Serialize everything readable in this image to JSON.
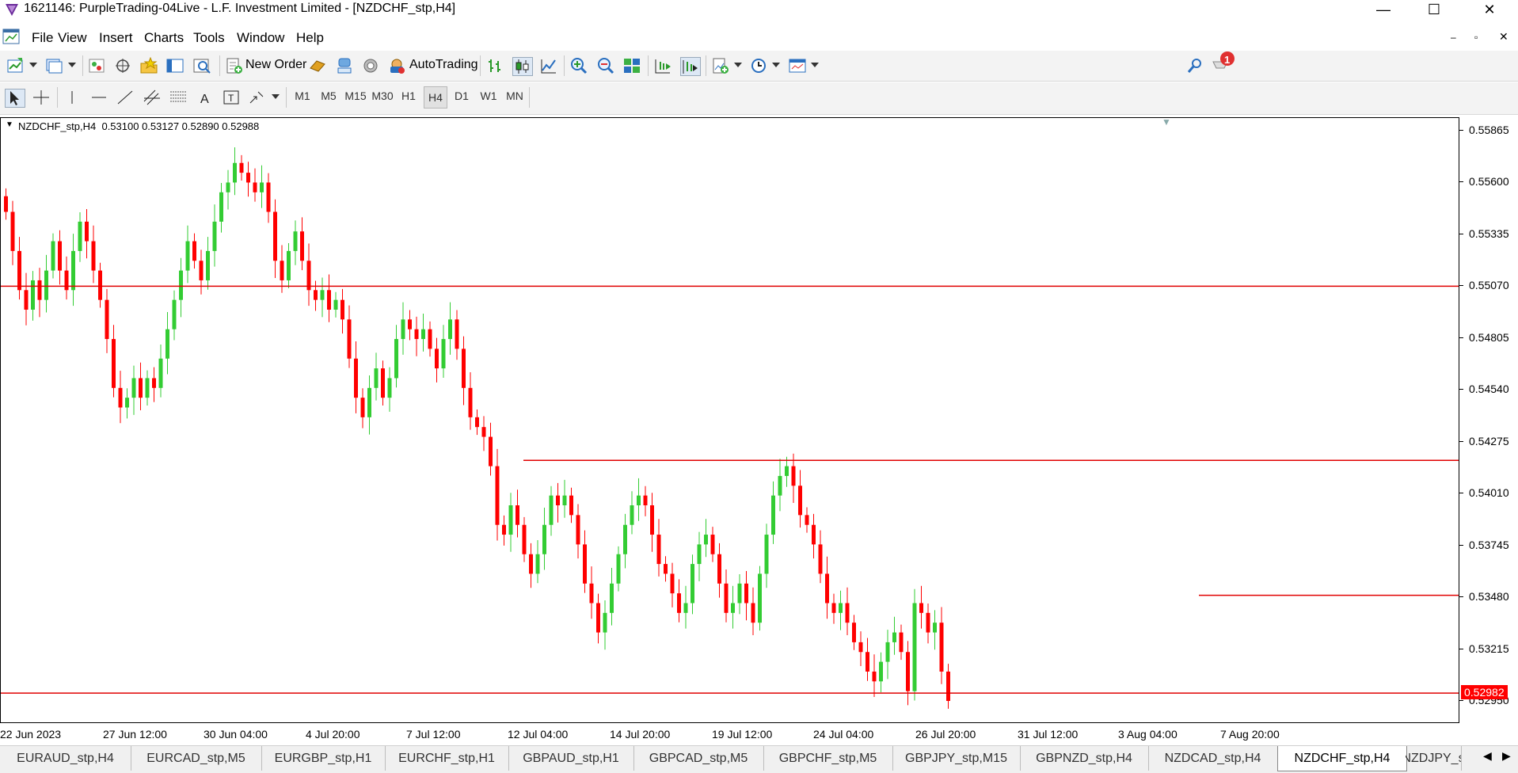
{
  "window": {
    "title": "1621146: PurpleTrading-04Live - L.F. Investment Limited - [NZDCHF_stp,H4]",
    "minimize": "—",
    "maximize": "☐",
    "close": "✕"
  },
  "menu": [
    "File",
    "View",
    "Insert",
    "Charts",
    "Tools",
    "Window",
    "Help"
  ],
  "toolbar": {
    "new_order": "New Order",
    "auto_trading": "AutoTrading",
    "notification_count": "1"
  },
  "timeframes": [
    "M1",
    "M5",
    "M15",
    "M30",
    "H1",
    "H4",
    "D1",
    "W1",
    "MN"
  ],
  "active_timeframe": "H4",
  "chart": {
    "info": "NZDCHF_stp,H4  0.53100 0.53127 0.52890 0.52988",
    "bull_color": "#33cc33",
    "bear_color": "#ff0000",
    "line_color": "#e00000",
    "current_price": "0.52982",
    "price_labels": [
      "0.55865",
      "0.55600",
      "0.55335",
      "0.55070",
      "0.54805",
      "0.54540",
      "0.54275",
      "0.54010",
      "0.53745",
      "0.53480",
      "0.53215",
      "0.52950"
    ],
    "time_labels": [
      "22 Jun 2023",
      "27 Jun 12:00",
      "30 Jun 04:00",
      "4 Jul 20:00",
      "7 Jul 12:00",
      "12 Jul 04:00",
      "14 Jul 20:00",
      "19 Jul 12:00",
      "24 Jul 04:00",
      "26 Jul 20:00",
      "31 Jul 12:00",
      "3 Aug 04:00",
      "7 Aug 20:00"
    ],
    "horizontal_lines": [
      0.5507,
      0.5418,
      0.5349,
      0.5299
    ],
    "close_prices": [
      0.5545,
      0.5525,
      0.5505,
      0.5495,
      0.551,
      0.55,
      0.5515,
      0.553,
      0.5515,
      0.5505,
      0.5525,
      0.554,
      0.553,
      0.5515,
      0.55,
      0.548,
      0.5455,
      0.5445,
      0.545,
      0.546,
      0.545,
      0.546,
      0.5455,
      0.547,
      0.5485,
      0.55,
      0.5515,
      0.553,
      0.552,
      0.551,
      0.5525,
      0.554,
      0.5555,
      0.556,
      0.557,
      0.5565,
      0.556,
      0.5555,
      0.556,
      0.5545,
      0.552,
      0.551,
      0.5525,
      0.5535,
      0.552,
      0.5505,
      0.55,
      0.5505,
      0.5495,
      0.55,
      0.549,
      0.547,
      0.545,
      0.544,
      0.5455,
      0.5465,
      0.545,
      0.546,
      0.548,
      0.549,
      0.5485,
      0.548,
      0.5485,
      0.5475,
      0.5465,
      0.548,
      0.549,
      0.5475,
      0.5455,
      0.544,
      0.5435,
      0.543,
      0.5415,
      0.5385,
      0.538,
      0.5395,
      0.5385,
      0.537,
      0.536,
      0.537,
      0.5385,
      0.54,
      0.5395,
      0.54,
      0.539,
      0.5375,
      0.5355,
      0.5345,
      0.533,
      0.534,
      0.5355,
      0.537,
      0.5385,
      0.5395,
      0.54,
      0.5395,
      0.538,
      0.5365,
      0.536,
      0.535,
      0.534,
      0.5345,
      0.5365,
      0.5375,
      0.538,
      0.537,
      0.5355,
      0.534,
      0.5345,
      0.5355,
      0.5345,
      0.5335,
      0.536,
      0.538,
      0.54,
      0.541,
      0.5415,
      0.5405,
      0.539,
      0.5385,
      0.5375,
      0.536,
      0.5345,
      0.534,
      0.5345,
      0.5335,
      0.5325,
      0.532,
      0.531,
      0.5305,
      0.5315,
      0.5325,
      0.533,
      0.532,
      0.53,
      0.5345,
      0.534,
      0.533,
      0.5335,
      0.531,
      0.5295
    ]
  },
  "tabs": [
    "EURAUD_stp,H4",
    "EURCAD_stp,M5",
    "EURGBP_stp,H1",
    "EURCHF_stp,H1",
    "GBPAUD_stp,H1",
    "GBPCAD_stp,M5",
    "GBPCHF_stp,M5",
    "GBPJPY_stp,M15",
    "GBPNZD_stp,H4",
    "NZDCAD_stp,H4",
    "NZDCHF_stp,H4",
    "NZDJPY_s"
  ],
  "active_tab": "NZDCHF_stp,H4"
}
